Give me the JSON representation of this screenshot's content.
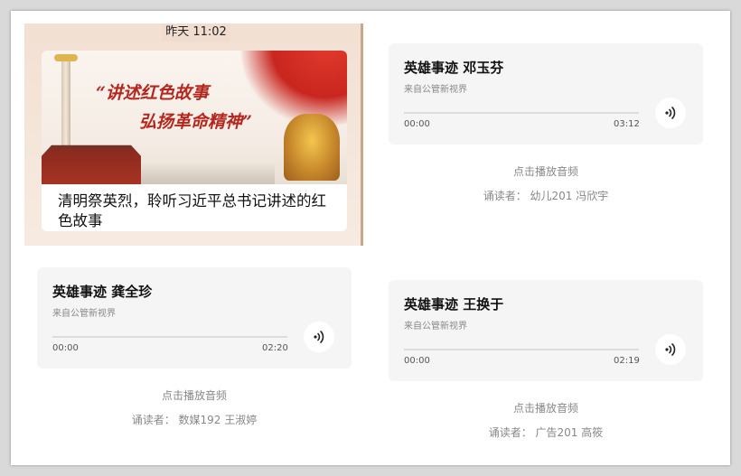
{
  "news": {
    "timestamp": "昨天 11:02",
    "slogan_line1": "“讲述红色故事",
    "slogan_line2": "弘扬革命精神”",
    "title": "清明祭英烈，聆听习近平总书记讲述的红色故事"
  },
  "audio_cards": [
    {
      "title": "英雄事迹 邓玉芬",
      "source": "来自公管新视界",
      "time_start": "00:00",
      "time_end": "03:12",
      "play_hint": "点击播放音频",
      "reader": "诵读者：  幼儿201 冯欣宇"
    },
    {
      "title": "英雄事迹 龚全珍",
      "source": "来自公管新视界",
      "time_start": "00:00",
      "time_end": "02:20",
      "play_hint": "点击播放音频",
      "reader": "诵读者：  数媒192 王淑婷"
    },
    {
      "title": "英雄事迹 王换于",
      "source": "来自公管新视界",
      "time_start": "00:00",
      "time_end": "02:19",
      "play_hint": "点击播放音频",
      "reader": "诵读者：  广告201 高筱"
    }
  ],
  "icons": {
    "play": "sound-wave-icon"
  },
  "colors": {
    "card_bg": "#f5f5f5",
    "accent_red": "#b4271e"
  }
}
